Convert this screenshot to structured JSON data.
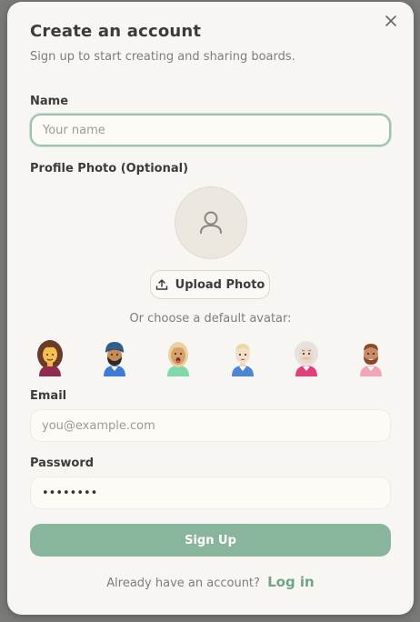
{
  "dialog": {
    "close_icon": "close-icon",
    "title": "Create an account",
    "subtitle": "Sign up to start creating and sharing boards."
  },
  "name_field": {
    "label": "Name",
    "placeholder": "Your name",
    "value": ""
  },
  "photo": {
    "label": "Profile Photo (Optional)",
    "placeholder_icon": "user-icon",
    "upload_label": "Upload Photo",
    "upload_icon": "upload-icon",
    "choose_text": "Or choose a default avatar:",
    "avatars": [
      "avatar-1",
      "avatar-2",
      "avatar-3",
      "avatar-4",
      "avatar-5",
      "avatar-6"
    ]
  },
  "email_field": {
    "label": "Email",
    "placeholder": "you@example.com",
    "value": ""
  },
  "password_field": {
    "label": "Password",
    "value": "••••••••"
  },
  "signup_label": "Sign Up",
  "footer": {
    "text": "Already have an account?",
    "login_label": "Log in"
  },
  "colors": {
    "accent": "#89b59c",
    "link": "#6fa485",
    "background": "#f8f6f2"
  }
}
